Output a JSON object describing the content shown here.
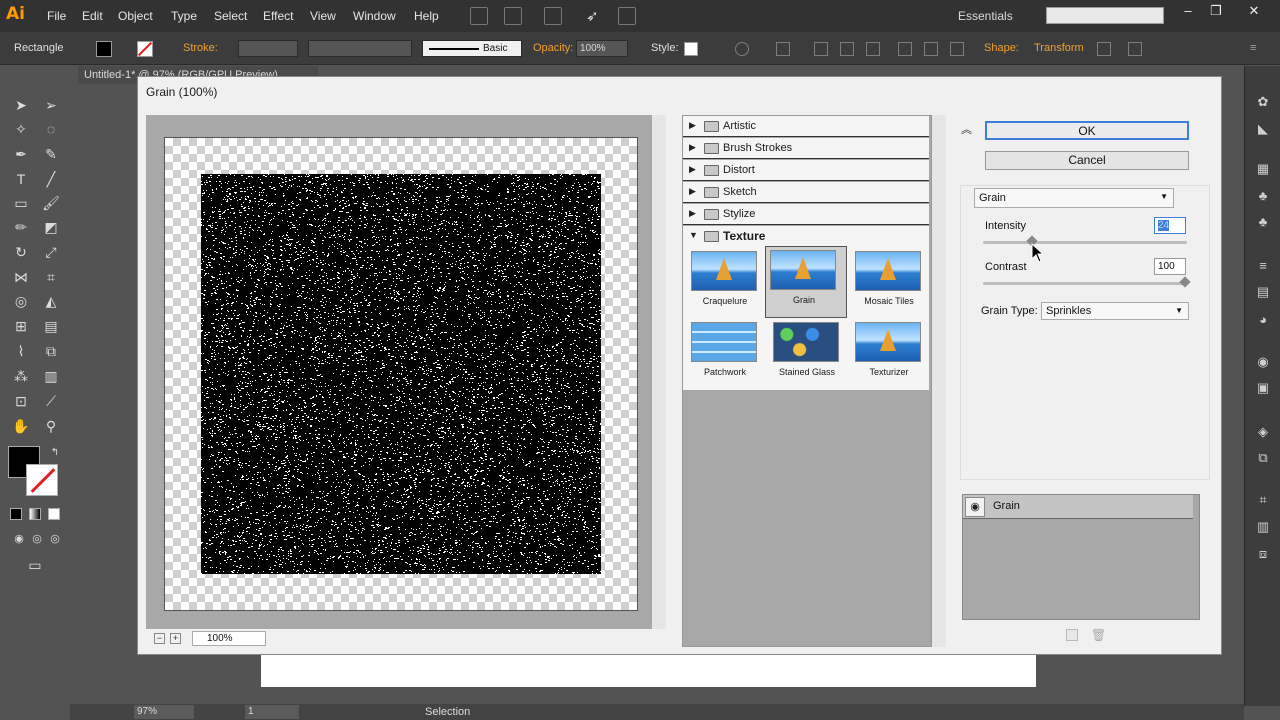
{
  "app": {
    "logo": "Ai",
    "menu": [
      "File",
      "Edit",
      "Object",
      "Type",
      "Select",
      "Effect",
      "View",
      "Window",
      "Help"
    ],
    "workspace": "Essentials",
    "doc_tab": "Untitled-1* @ 97% (RGB/GPU Preview)"
  },
  "control_bar": {
    "tool_name": "Rectangle",
    "stroke_label": "Stroke:",
    "brush_label": "Basic",
    "opacity_label": "Opacity:",
    "opacity_value": "100%",
    "style_label": "Style:",
    "shape_label": "Shape:",
    "transform_label": "Transform"
  },
  "dialog": {
    "title": "Grain (100%)",
    "zoom": "100%",
    "categories": [
      "Artistic",
      "Brush Strokes",
      "Distort",
      "Sketch",
      "Stylize",
      "Texture"
    ],
    "texture_filters": [
      "Craquelure",
      "Grain",
      "Mosaic Tiles",
      "Patchwork",
      "Stained Glass",
      "Texturizer"
    ],
    "selected_filter": "Grain",
    "ok_label": "OK",
    "cancel_label": "Cancel",
    "filter_select": "Grain",
    "intensity_label": "Intensity",
    "intensity_value": "24",
    "contrast_label": "Contrast",
    "contrast_value": "100",
    "grain_type_label": "Grain Type:",
    "grain_type_value": "Sprinkles",
    "layer_name": "Grain"
  },
  "status": {
    "zoom": "97%",
    "artboard": "1",
    "tool": "Selection"
  }
}
